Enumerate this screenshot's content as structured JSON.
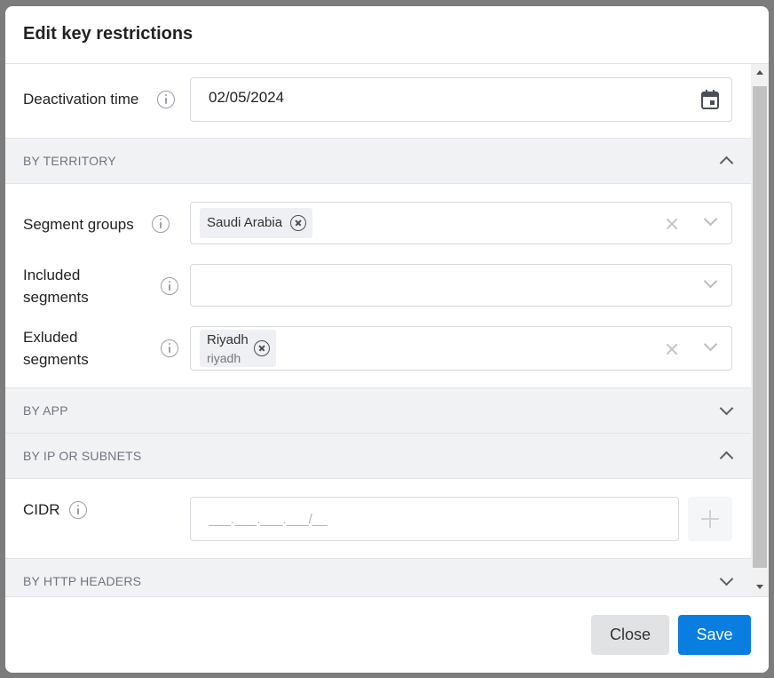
{
  "modal": {
    "title": "Edit key restrictions"
  },
  "deactivation": {
    "label": "Deactivation time",
    "value": "02/05/2024"
  },
  "sections": {
    "territory": "BY TERRITORY",
    "app": "BY APP",
    "ip": "BY IP OR SUBNETS",
    "http": "BY HTTP HEADERS"
  },
  "territory": {
    "segment_groups": {
      "label": "Segment groups",
      "chips": [
        {
          "label": "Saudi Arabia"
        }
      ]
    },
    "included_segments": {
      "label_line1": "Included",
      "label_line2": "segments"
    },
    "excluded_segments": {
      "label_line1": "Exluded",
      "label_line2": "segments",
      "chips": [
        {
          "label": "Riyadh",
          "sublabel": "riyadh"
        }
      ]
    }
  },
  "ip": {
    "cidr_label": "CIDR",
    "cidr_placeholder": "___.___.___.___/__"
  },
  "footer": {
    "close_label": "Close",
    "save_label": "Save"
  },
  "colors": {
    "primary": "#0a7de0",
    "section_bg": "#f1f2f4",
    "overlay": "#7c7c7c"
  },
  "icons": [
    "info-icon",
    "calendar-icon",
    "chevron-up-icon",
    "chevron-down-icon",
    "remove-chip-icon",
    "clear-icon",
    "plus-icon"
  ]
}
